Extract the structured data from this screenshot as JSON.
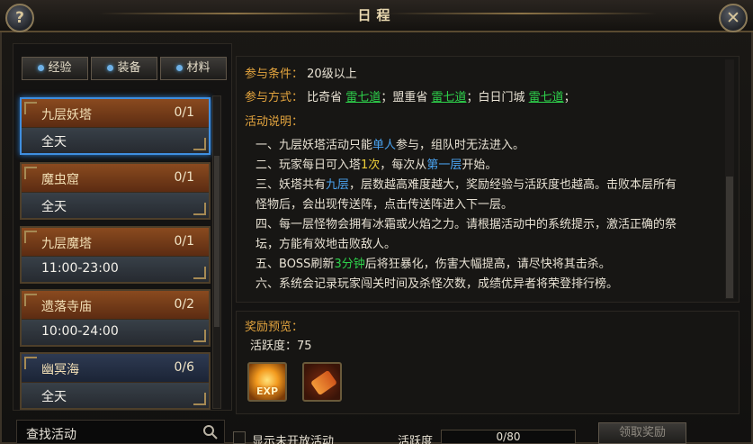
{
  "window": {
    "title": "日程",
    "help": "?",
    "close": "✕"
  },
  "tabs": [
    {
      "label": "经验"
    },
    {
      "label": "装备"
    },
    {
      "label": "材料"
    }
  ],
  "activities": [
    {
      "name": "九层妖塔",
      "count": "0/1",
      "time": "全天",
      "selected": true
    },
    {
      "name": "魔虫窟",
      "count": "0/1",
      "time": "全天"
    },
    {
      "name": "九层魔塔",
      "count": "0/1",
      "time": "11:00-23:00"
    },
    {
      "name": "遗落寺庙",
      "count": "0/2",
      "time": "10:00-24:00"
    },
    {
      "name": "幽冥海",
      "count": "0/6",
      "time": "全天"
    }
  ],
  "search": {
    "text": "查找活动"
  },
  "details": {
    "condition_label": "参与条件：",
    "condition_value": "20级以上",
    "method_label": "参与方式：",
    "method_parts": [
      "比奇省",
      "雷七道",
      "；盟重省",
      "雷七道",
      "；白日门城",
      "雷七道",
      "；"
    ],
    "desc_label": "活动说明：",
    "lines": [
      [
        "一、九层妖塔活动只能",
        "单人",
        "参与，组队时无法进入。"
      ],
      [
        "二、玩家每日可入塔",
        "1次",
        "，每次从",
        "第一层",
        "开始。"
      ],
      [
        "三、妖塔共有",
        "九层",
        "，层数越高难度越大，奖励经验与活跃度也越高。击败本层所有"
      ],
      [
        "怪物后，会出现传送阵，点击传送阵进入下一层。"
      ],
      [
        "四、每一层怪物会拥有冰霜或火焰之力。请根据活动中的系统提示，激活正确的祭"
      ],
      [
        "坛，方能有效地击败敌人。"
      ],
      [
        "五、BOSS刷新",
        "3分钟",
        "后将狂暴化，伤害大幅提高，请尽快将其击杀。"
      ],
      [
        "六、系统会记录玩家闯关时间及杀怪次数，成绩优异者将荣登排行榜。"
      ]
    ]
  },
  "reward": {
    "label": "奖励预览：",
    "activeness": "活跃度：75",
    "items": [
      {
        "icon": "exp-icon",
        "text": "EXP"
      },
      {
        "icon": "scroll-icon"
      }
    ]
  },
  "footer": {
    "show_unopened": "显示未开放活动",
    "activeness_label": "活跃度",
    "progress_text": "0/80",
    "progress_value": 0,
    "claim_button": "领取奖励"
  },
  "colors": {
    "accent_label": "#e3a43e",
    "link_green": "#2ed34b",
    "highlight_blue": "#4aa3f0",
    "highlight_yellow": "#f0d23a",
    "selected_border": "#3f8fe0"
  }
}
